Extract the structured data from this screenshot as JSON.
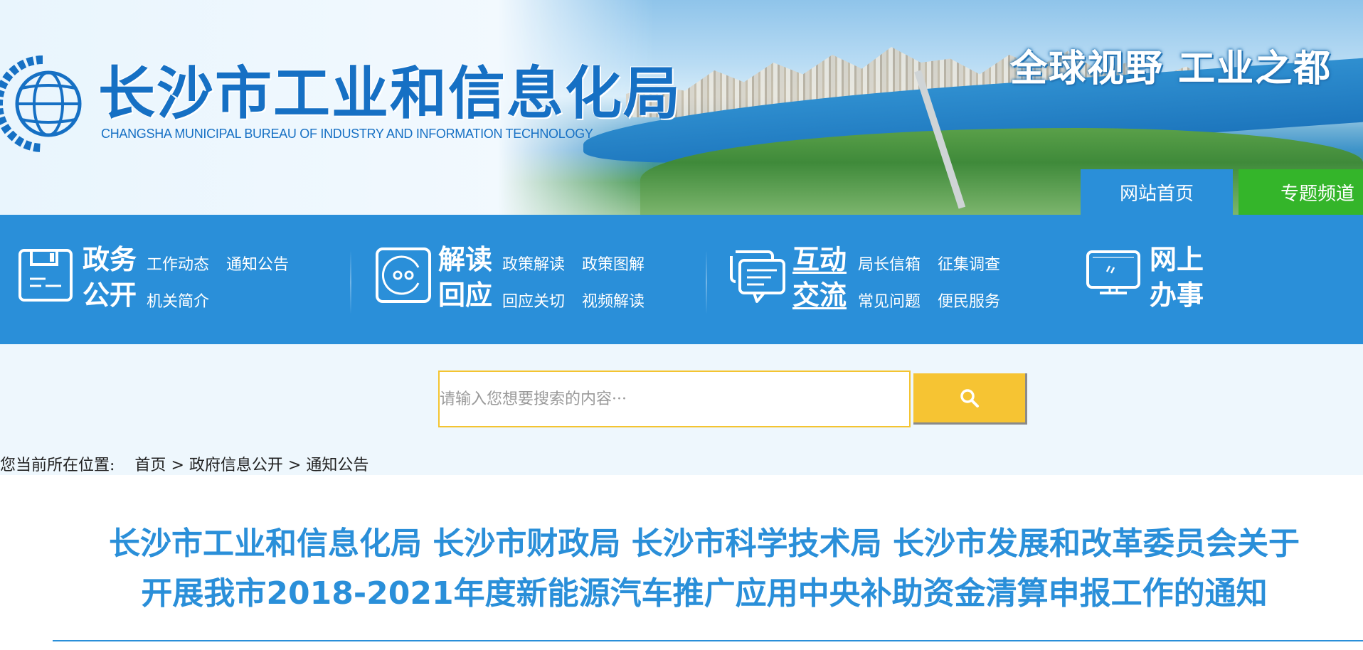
{
  "header": {
    "title": "长沙市工业和信息化局",
    "subtitle": "CHANGSHA MUNICIPAL BUREAU OF INDUSTRY AND INFORMATION TECHNOLOGY",
    "slogan": "全球视野 工业之都",
    "tabs": {
      "home": "网站首页",
      "special": "专题频道"
    }
  },
  "nav": {
    "groups": [
      {
        "title_line1": "政务",
        "title_line2": "公开",
        "links": [
          "工作动态",
          "通知公告",
          "机关简介"
        ],
        "icon": "save-icon"
      },
      {
        "title_line1": "解读",
        "title_line2": "回应",
        "links": [
          "政策解读",
          "政策图解",
          "回应关切",
          "视频解读"
        ],
        "icon": "face-icon"
      },
      {
        "title_line1": "互动",
        "title_line2": "交流",
        "links": [
          "局长信箱",
          "征集调查",
          "常见问题",
          "便民服务"
        ],
        "icon": "chat-icon"
      },
      {
        "title_line1": "网上",
        "title_line2": "办事",
        "links": [],
        "icon": "monitor-icon"
      }
    ]
  },
  "search": {
    "placeholder": "请输入您想要搜索的内容···",
    "button_icon": "search-icon"
  },
  "breadcrumb": {
    "label": "您当前所在位置:",
    "items": [
      "首页",
      "政府信息公开",
      "通知公告"
    ],
    "separator": ">"
  },
  "article": {
    "title_line1": "长沙市工业和信息化局 长沙市财政局 长沙市科学技术局 长沙市发展和改革委员会关于",
    "title_line2": "开展我市2018-2021年度新能源汽车推广应用中央补助资金清算申报工作的通知"
  },
  "colors": {
    "primary": "#2a8fd9",
    "green_tab": "#34b52a",
    "search_button": "#f6c433",
    "title_blue": "#1670c4"
  }
}
